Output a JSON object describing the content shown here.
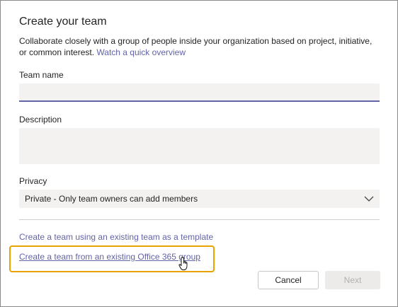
{
  "dialog": {
    "title": "Create your team",
    "intro_text": "Collaborate closely with a group of people inside your organization based on project, initiative, or common interest.",
    "intro_link": "Watch a quick overview"
  },
  "form": {
    "team_name": {
      "label": "Team name",
      "value": "",
      "placeholder": ""
    },
    "description": {
      "label": "Description",
      "value": "",
      "placeholder": ""
    },
    "privacy": {
      "label": "Privacy",
      "selected": "Private - Only team owners can add members"
    }
  },
  "links": {
    "template": "Create a team using an existing team as a template",
    "office365": "Create a team from an existing Office 365 group"
  },
  "buttons": {
    "cancel": "Cancel",
    "next": "Next"
  },
  "colors": {
    "accent": "#6264a7",
    "highlight": "#e8a202",
    "field_bg": "#f3f2f1"
  },
  "icons": {
    "dropdown": "chevron-down-icon",
    "cursor": "hand-pointer-icon"
  }
}
